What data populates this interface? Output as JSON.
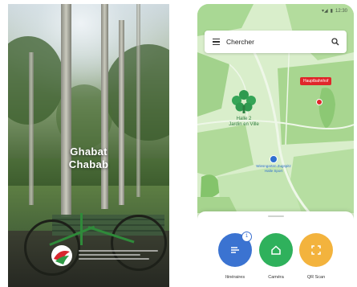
{
  "splash": {
    "title_line1": "Ghabat",
    "title_line2": "Chabab"
  },
  "map_screen": {
    "status": {
      "signal": "▾◢",
      "battery": "▮",
      "time": "12:30"
    },
    "search": {
      "label": "Chercher"
    },
    "places": {
      "park_label_line1": "Halle 2",
      "park_label_line2": "Jardin en Ville",
      "hall_badge": "Hauptbahnhof",
      "blue_label_line1": "Wiesngarten Zugspitz",
      "blue_label_line2": "Halle Sport"
    },
    "actions": [
      {
        "label": "Itinéraires",
        "color": "#3b73d1",
        "icon": "directions-icon",
        "badge": "1"
      },
      {
        "label": "Caméra",
        "color": "#2fb15c",
        "icon": "camera-icon"
      },
      {
        "label": "QR Scan",
        "color": "#f3b33d",
        "icon": "qr-scan-icon"
      }
    ]
  }
}
